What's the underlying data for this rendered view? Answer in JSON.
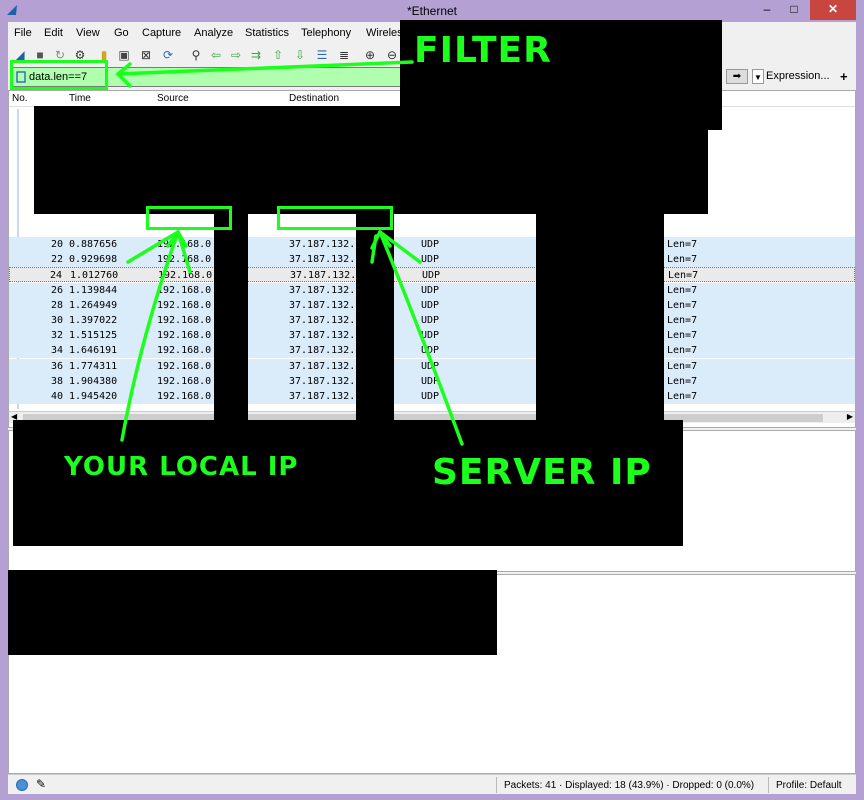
{
  "window": {
    "title": "*Ethernet",
    "minimize": "–",
    "maximize": "□",
    "close": "✕"
  },
  "menu": [
    "File",
    "Edit",
    "View",
    "Go",
    "Capture",
    "Analyze",
    "Statistics",
    "Telephony",
    "Wireles"
  ],
  "filter": {
    "value": "data.len==7",
    "apply_icon": "arrow-right-icon",
    "dropdown_icon": "chevron-down-icon",
    "expression_label": "Expression...",
    "plus_label": "+"
  },
  "packet_list": {
    "columns": [
      "No.",
      "Time",
      "Source",
      "Destination"
    ],
    "rows": [
      {
        "no": "20",
        "time": "0.887656",
        "source": "192.168.0",
        "destination": "37.187.132.",
        "protocol": "UDP",
        "info": "Len=7"
      },
      {
        "no": "22",
        "time": "0.929698",
        "source": "192.168.0",
        "destination": "37.187.132.",
        "protocol": "UDP",
        "info": "Len=7"
      },
      {
        "no": "24",
        "time": "1.012760",
        "source": "192.168.0",
        "destination": "37.187.132.",
        "protocol": "UDP",
        "info": "Len=7",
        "selected": true
      },
      {
        "no": "26",
        "time": "1.139844",
        "source": "192.168.0",
        "destination": "37.187.132.",
        "protocol": "UDP",
        "info": "Len=7"
      },
      {
        "no": "28",
        "time": "1.264949",
        "source": "192.168.0",
        "destination": "37.187.132.",
        "protocol": "UDP",
        "info": "Len=7"
      },
      {
        "no": "30",
        "time": "1.397022",
        "source": "192.168.0",
        "destination": "37.187.132.",
        "protocol": "UDP",
        "info": "Len=7"
      },
      {
        "no": "32",
        "time": "1.515125",
        "source": "192.168.0",
        "destination": "37.187.132.",
        "protocol": "UDP",
        "info": "Len=7"
      },
      {
        "no": "34",
        "time": "1.646191",
        "source": "192.168.0",
        "destination": "37.187.132.",
        "protocol": "UDP",
        "info": "Len=7"
      },
      {
        "no": "36",
        "time": "1.774311",
        "source": "192.168.0",
        "destination": "37.187.132.",
        "protocol": "UDP",
        "info": "Len=7"
      },
      {
        "no": "38",
        "time": "1.904380",
        "source": "192.168.0",
        "destination": "37.187.132.",
        "protocol": "UDP",
        "info": "Len=7"
      },
      {
        "no": "40",
        "time": "1.945420",
        "source": "192.168.0",
        "destination": "37.187.132.",
        "protocol": "UDP",
        "info": "Len=7"
      }
    ]
  },
  "status": {
    "packets": "Packets: 41 · Displayed: 18 (43.9%) · Dropped: 0 (0.0%)",
    "profile": "Profile: Default"
  },
  "annotations": {
    "filter": "FILTER",
    "local_ip": "YOUR LOCAL IP",
    "server_ip": "SERVER IP"
  },
  "colors": {
    "annotation_green": "#1cff1c",
    "filter_bg": "#afffaf",
    "row_bg": "#daebfa",
    "title_bar": "#b4a0d2",
    "close_button": "#c7463f"
  }
}
